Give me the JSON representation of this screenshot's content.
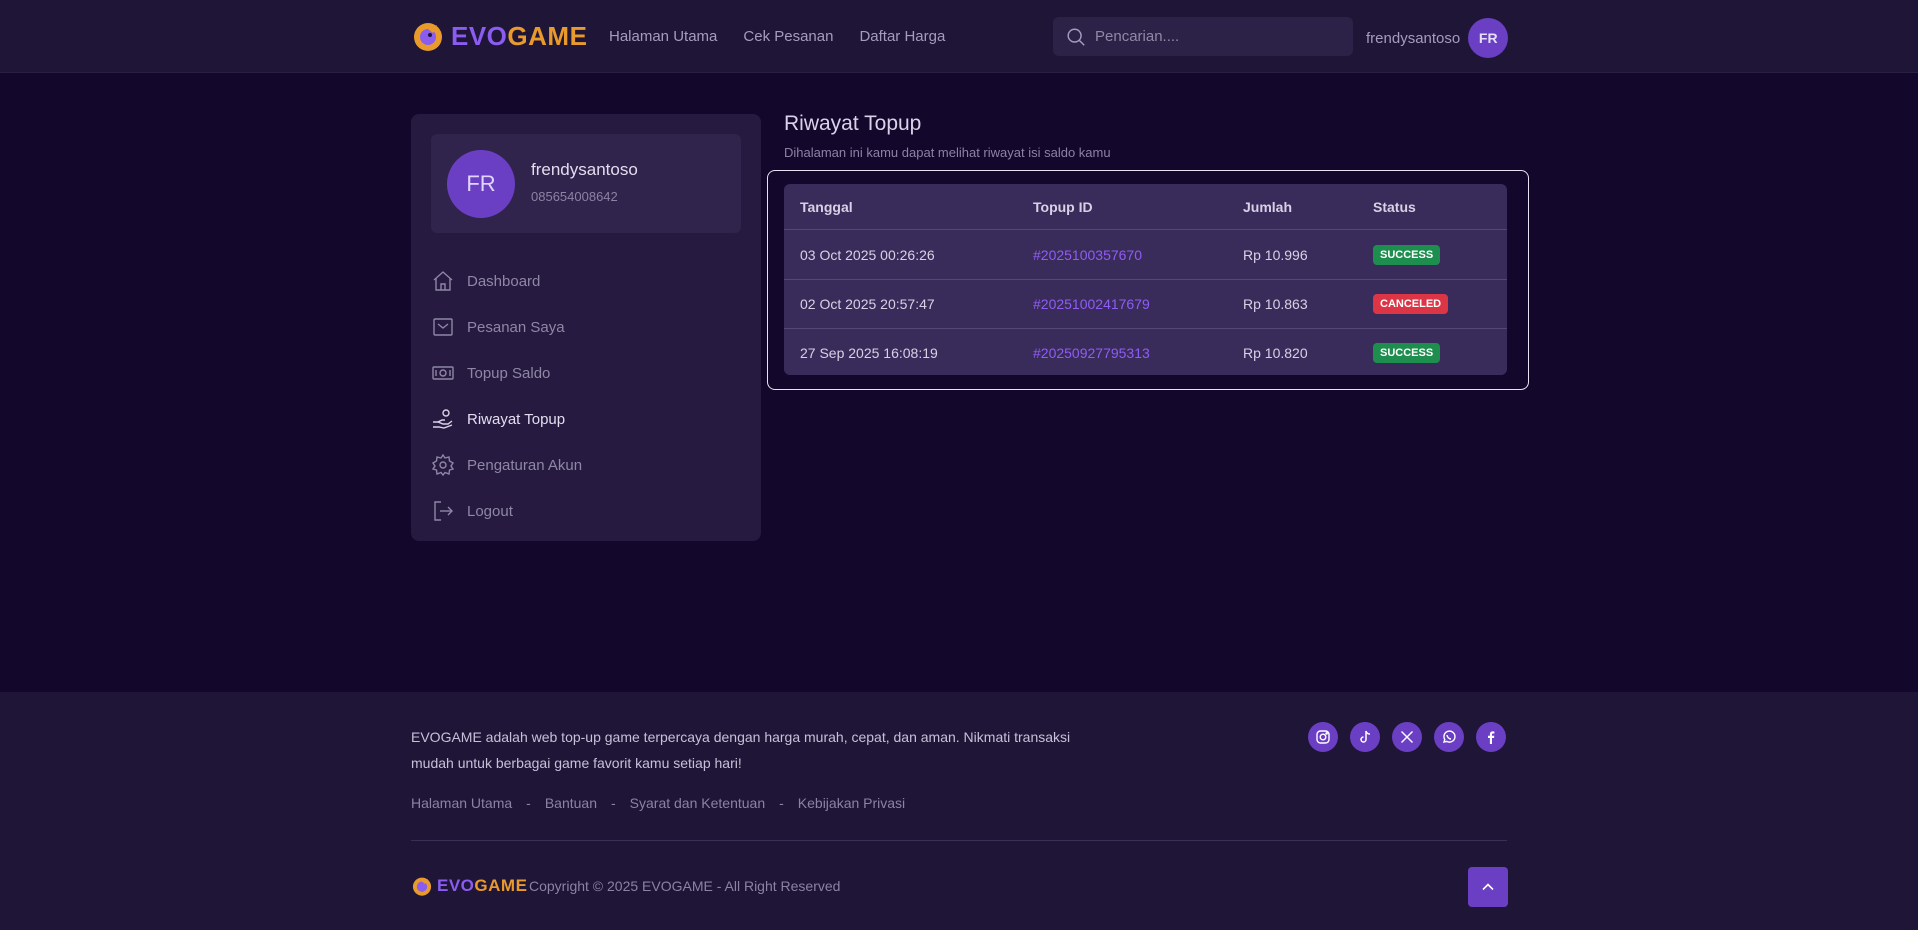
{
  "brand": {
    "logo_evo": "EVO",
    "logo_game": "GAME",
    "accent": "#6b3fc4",
    "evo_color": "#8a5cf0",
    "game_color": "#e89a2d"
  },
  "header": {
    "nav": [
      "Halaman Utama",
      "Cek Pesanan",
      "Daftar Harga"
    ],
    "search_placeholder": "Pencarian....",
    "username": "frendysantoso",
    "avatar_initials": "FR"
  },
  "sidebar": {
    "profile": {
      "initials": "FR",
      "name": "frendysantoso",
      "phone": "085654008642"
    },
    "items": [
      {
        "label": "Dashboard",
        "icon": "home-icon"
      },
      {
        "label": "Pesanan Saya",
        "icon": "inbox-icon"
      },
      {
        "label": "Topup Saldo",
        "icon": "money-icon"
      },
      {
        "label": "Riwayat Topup",
        "icon": "hand-coins-icon",
        "active": true
      },
      {
        "label": "Pengaturan Akun",
        "icon": "gear-icon"
      },
      {
        "label": "Logout",
        "icon": "logout-icon"
      }
    ]
  },
  "main": {
    "title": "Riwayat Topup",
    "subtitle": "Dihalaman ini kamu dapat melihat riwayat isi saldo kamu",
    "columns": [
      "Tanggal",
      "Topup ID",
      "Jumlah",
      "Status"
    ],
    "rows": [
      {
        "date": "03 Oct 2025 00:26:26",
        "id": "#2025100357670",
        "amount": "Rp 10.996",
        "status": "SUCCESS",
        "status_color": "#1d8e4e"
      },
      {
        "date": "02 Oct 2025 20:57:47",
        "id": "#2025100241767​9",
        "amount": "Rp 10.863",
        "status": "CANCELED",
        "status_color": "#dc3545"
      },
      {
        "date": "27 Sep 2025 16:08:19",
        "id": "#20250927795313",
        "amount": "Rp 10.820",
        "status": "SUCCESS",
        "status_color": "#1d8e4e"
      }
    ]
  },
  "footer": {
    "description": "EVOGAME adalah web top-up game terpercaya dengan harga murah, cepat, dan aman. Nikmati transaksi mudah untuk berbagai game favorit kamu setiap hari!",
    "links": [
      "Halaman Utama",
      "Bantuan",
      "Syarat dan Ketentuan",
      "Kebijakan Privasi"
    ],
    "separator": "-",
    "socials": [
      "instagram-icon",
      "tiktok-icon",
      "x-icon",
      "whatsapp-icon",
      "facebook-icon"
    ],
    "copyright": "Copyright © 2025 EVOGAME - All Right Reserved"
  }
}
